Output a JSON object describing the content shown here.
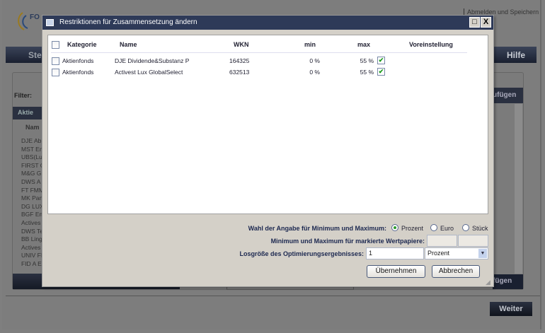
{
  "background": {
    "logo_text": "FO",
    "top_link": "Abmelden und Speichern",
    "nav_left": "Ste",
    "nav_right": "Hilfe",
    "filter_label": "Filter:",
    "group_label": "Aktie",
    "column_name": "Nam",
    "add_button_top": "ufügen",
    "add_button_bottom": "fügen",
    "list_items": [
      "DJE Ab",
      "MST Em",
      "UBS(Lu",
      "FIRST C",
      "M&G G",
      "DWS A",
      "FT FMM",
      "MK Pan",
      "DG LUX",
      "BGF Em",
      "Actives",
      "DWS Te",
      "BB Ling",
      "Actives",
      "UNIV FI",
      "FID A E"
    ],
    "next_button": "Weiter"
  },
  "dialog": {
    "title": "Restriktionen für Zusammensetzung ändern",
    "maximize_icon": "maximize-icon",
    "close_label": "X",
    "columns": [
      "Kategorie",
      "Name",
      "WKN",
      "min",
      "max",
      "Voreinstellung"
    ],
    "rows": [
      {
        "kategorie": "Aktienfonds",
        "name": "DJE Dividende&Substanz P",
        "wkn": "164325",
        "min": "0 %",
        "max": "55 %",
        "max_checked": true
      },
      {
        "kategorie": "Aktienfonds",
        "name": "Activest Lux GlobalSelect",
        "wkn": "632513",
        "min": "0 %",
        "max": "55 %",
        "max_checked": true
      }
    ],
    "unit_label": "Wahl der Angabe für Minimum und Maximum:",
    "unit_options": [
      "Prozent",
      "Euro",
      "Stück"
    ],
    "unit_selected": "Prozent",
    "minmax_label": "Minimum und Maximum für markierte Wertpapiere:",
    "minmax_min": "",
    "minmax_max": "",
    "lot_label": "Losgröße des Optimierungsergebnisses:",
    "lot_value": "1",
    "lot_unit": "Prozent",
    "apply_button": "Übernehmen",
    "cancel_button": "Abbrechen",
    "accent_color": "#2e3a58"
  }
}
